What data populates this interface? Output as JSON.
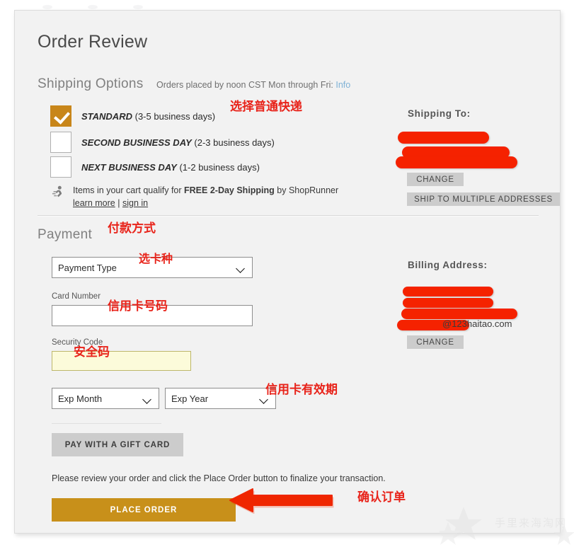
{
  "page": {
    "title": "Order Review"
  },
  "shipping": {
    "heading": "Shipping Options",
    "note": "Orders placed by noon CST Mon through Fri:",
    "info_link": "Info",
    "options": [
      {
        "name": "STANDARD",
        "detail": "(3-5 business days)",
        "checked": true
      },
      {
        "name": "SECOND BUSINESS DAY",
        "detail": "(2-3 business days)",
        "checked": false
      },
      {
        "name": "NEXT BUSINESS DAY",
        "detail": "(1-2 business days)",
        "checked": false
      }
    ],
    "shoprunner": {
      "icon": "shoprunner-runner-icon",
      "text_before": "Items in your cart qualify for ",
      "text_bold": "FREE 2-Day Shipping",
      "text_after": " by ShopRunner",
      "learn_more": "learn more",
      "separator": "|",
      "sign_in": "sign in"
    }
  },
  "shipping_to": {
    "heading": "Shipping To:",
    "redacted_lines": 3,
    "change_label": "CHANGE",
    "multiple_label": "SHIP TO MULTIPLE ADDRESSES"
  },
  "billing": {
    "heading": "Billing Address:",
    "redacted_lines": 4,
    "email_visible": "@123haitao.com",
    "change_label": "CHANGE"
  },
  "payment": {
    "heading": "Payment",
    "payment_type_value": "Payment Type",
    "card_number_label": "Card Number",
    "card_number_value": "",
    "security_code_label": "Security Code",
    "security_code_value": "",
    "exp_month_value": "Exp Month",
    "exp_year_value": "Exp Year",
    "gift_card_label": "PAY WITH A GIFT CARD"
  },
  "footer": {
    "review_text": "Please review your order and click the Place Order button to finalize your transaction.",
    "place_order_label": "PLACE ORDER"
  },
  "annotations": {
    "shipping": "选择普通快递",
    "payment": "付款方式",
    "card_type": "选卡种",
    "card_number": "信用卡号码",
    "security_code": "安全码",
    "expiry": "信用卡有效期",
    "place_order": "确认订单",
    "color": "#e8231a"
  },
  "watermark": {
    "text": "手里来海淘网",
    "icon": "star-icon"
  },
  "colors": {
    "accent_gold": "#c8901a",
    "checkbox_checked": "#c8861a",
    "redaction_red": "#f52200",
    "button_gray": "#cccccc",
    "card_background": "#f2f2f2",
    "link_blue": "#7fb2d6",
    "security_field": "#fcfbda"
  }
}
